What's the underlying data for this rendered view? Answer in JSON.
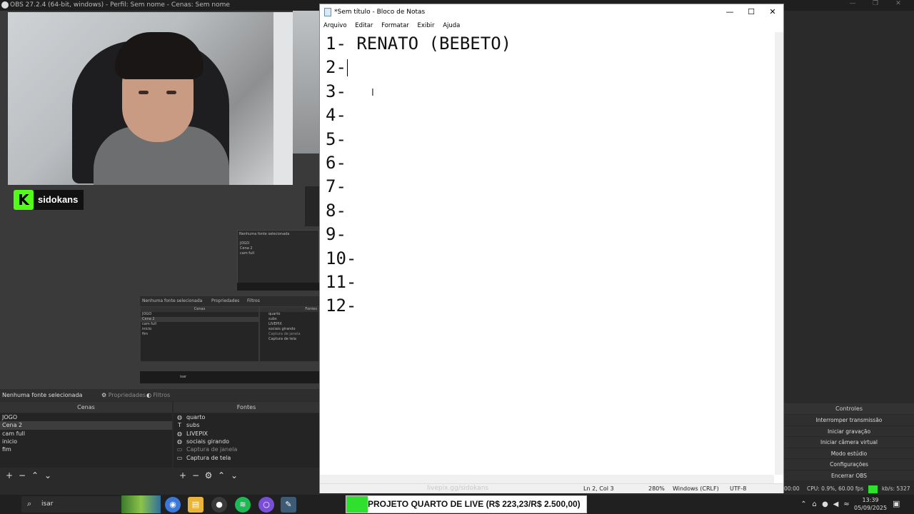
{
  "obs": {
    "title": "OBS 27.2.4 (64-bit, windows) - Perfil: Sem nome - Cenas: Sem nome",
    "brand_logo_letter": "K",
    "brand_name": "sidokans",
    "mini_hdr": "Nenhuma fonte selecionada",
    "mini_props": "Propriedades",
    "mini_filters": "Filtros",
    "mini_scenes_label": "Cenas",
    "mini_sources_label": "Fontes",
    "mini_scene_items": [
      "JOGO",
      "Cena 2",
      "cam full",
      "inicio",
      "fim"
    ],
    "mini_source_items": [
      "quarto",
      "subs",
      "LIVEPIX",
      "sociais girando",
      "Captura de janela",
      "Captura de tela"
    ],
    "mini_search": "isar",
    "dock": {
      "no_source": "Nenhuma fonte selecionada",
      "properties": "Propriedades",
      "filters": "Filtros"
    },
    "scenes": {
      "header": "Cenas",
      "items": [
        "JOGO",
        "Cena 2",
        "cam full",
        "inicio",
        "fim"
      ]
    },
    "sources": {
      "header": "Fontes",
      "items": [
        {
          "icon": "globe-icon",
          "glyph": "◍",
          "label": "quarto"
        },
        {
          "icon": "text-icon",
          "glyph": "T",
          "label": "subs"
        },
        {
          "icon": "globe-icon",
          "glyph": "◍",
          "label": "LIVEPIX"
        },
        {
          "icon": "globe-icon",
          "glyph": "◍",
          "label": "sociais girando"
        },
        {
          "icon": "window-capture-icon",
          "glyph": "▭",
          "label": "Captura de janela"
        },
        {
          "icon": "display-capture-icon",
          "glyph": "▭",
          "label": "Captura de tela"
        }
      ]
    },
    "controls": {
      "header": "Controles",
      "buttons": [
        "Interromper transmissão",
        "Iniciar gravação",
        "Iniciar câmera virtual",
        "Modo estúdio",
        "Configurações",
        "Encerrar OBS"
      ]
    },
    "status": {
      "time": "00:00",
      "cpu": "CPU: 0.9%, 60.00 fps",
      "bitrate": "kb/s: 5327"
    }
  },
  "notepad": {
    "title": "*Sem título - Bloco de Notas",
    "menu": [
      "Arquivo",
      "Editar",
      "Formatar",
      "Exibir",
      "Ajuda"
    ],
    "lines": [
      "1- RENATO (BEBETO)",
      "2-",
      "3-",
      "4-",
      "5-",
      "6-",
      "7-",
      "8-",
      "9-",
      "10-",
      "11-",
      "12-"
    ],
    "status": {
      "position": "Ln 2, Col 3",
      "zoom": "280%",
      "line_ending": "Windows (CRLF)",
      "encoding": "UTF-8"
    },
    "watermark": "livepix.gg/sidokans"
  },
  "taskbar": {
    "search_text": "isar",
    "goal_text": "PROJETO QUARTO DE LIVE (R$ 223,23/R$ 2.500,00)",
    "goal_progress": 0.0893,
    "clock_time": "13:39",
    "clock_date": "05/09/2025"
  },
  "colors": {
    "live_green": "#2fe02f",
    "kick_green": "#53fc18"
  }
}
